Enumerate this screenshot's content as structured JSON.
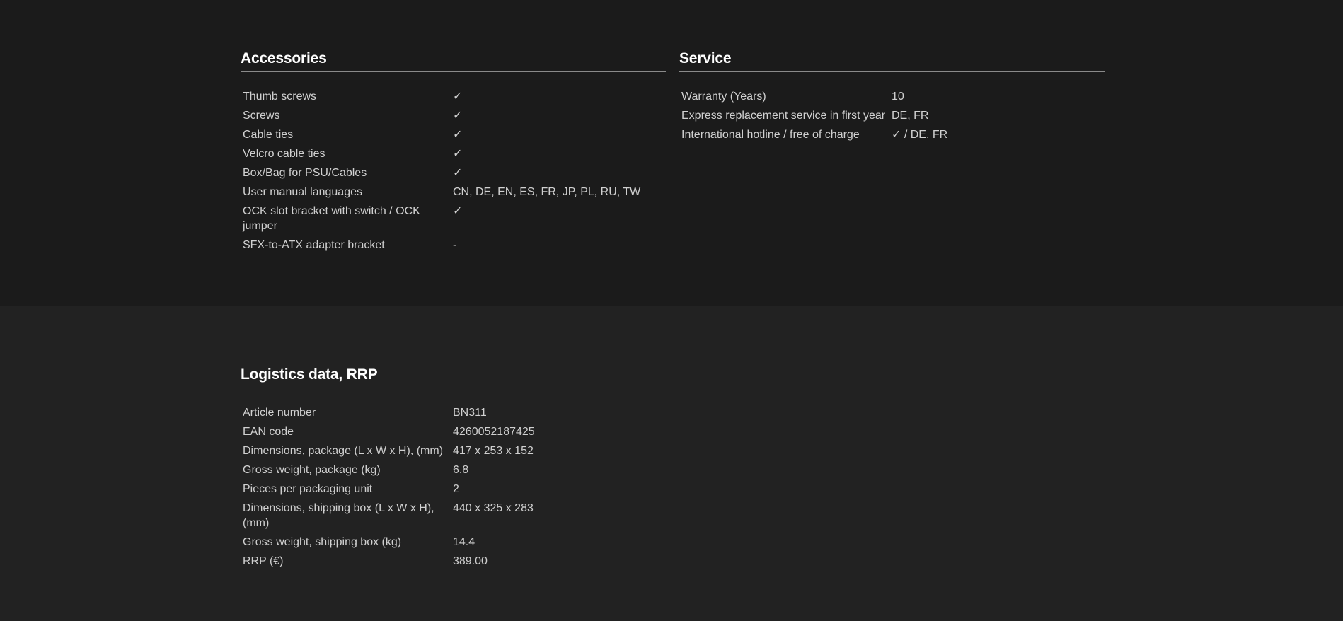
{
  "accessories": {
    "title": "Accessories",
    "rows": [
      {
        "key": "Thumb screws",
        "value": "✓"
      },
      {
        "key": "Screws",
        "value": "✓"
      },
      {
        "key": "Cable ties",
        "value": "✓"
      },
      {
        "key": "Velcro cable ties",
        "value": "✓"
      },
      {
        "key_parts": [
          "Box/Bag for ",
          "PSU",
          "/Cables"
        ],
        "value": "✓"
      },
      {
        "key": "User manual languages",
        "value": "CN, DE, EN, ES, FR, JP, PL, RU, TW"
      },
      {
        "key": "OCK slot bracket with switch / OCK jumper",
        "value": "✓"
      },
      {
        "key_parts": [
          "SFX",
          "-to-",
          "ATX",
          " adapter bracket"
        ],
        "value": "-"
      }
    ]
  },
  "service": {
    "title": "Service",
    "rows": [
      {
        "key": "Warranty (Years)",
        "value": "10"
      },
      {
        "key": "Express replacement service in first year",
        "value": "DE, FR"
      },
      {
        "key": "International hotline / free of charge",
        "value": "✓ / DE, FR"
      }
    ]
  },
  "logistics": {
    "title": "Logistics data, RRP",
    "rows": [
      {
        "key": "Article number",
        "value": "BN311"
      },
      {
        "key": "EAN code",
        "value": "4260052187425"
      },
      {
        "key": "Dimensions, package (L x W x H), (mm)",
        "value": "417 x 253 x 152"
      },
      {
        "key": "Gross weight, package (kg)",
        "value": "6.8"
      },
      {
        "key": "Pieces per packaging unit",
        "value": "2"
      },
      {
        "key": "Dimensions, shipping box (L x W x H), (mm)",
        "value": "440 x 325 x 283"
      },
      {
        "key": "Gross weight, shipping box (kg)",
        "value": "14.4"
      },
      {
        "key": "RRP (€)",
        "value": "389.00"
      }
    ]
  }
}
